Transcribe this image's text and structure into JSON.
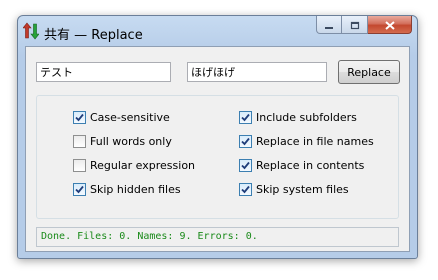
{
  "window": {
    "title": "共有 — Replace",
    "icon": "up-down-arrows-icon"
  },
  "caption": {
    "minimize_icon": "minimize-icon",
    "maximize_icon": "maximize-icon",
    "close_icon": "close-icon"
  },
  "search": {
    "find_value": "テスト",
    "replace_value": "ほげほげ"
  },
  "replace_button": {
    "label": "Replace"
  },
  "options": [
    {
      "label": "Case-sensitive",
      "checked": true
    },
    {
      "label": "Full words only",
      "checked": false
    },
    {
      "label": "Regular expression",
      "checked": false
    },
    {
      "label": "Skip hidden files",
      "checked": true
    },
    {
      "label": "Include subfolders",
      "checked": true
    },
    {
      "label": "Replace in file names",
      "checked": true
    },
    {
      "label": "Replace in contents",
      "checked": true
    },
    {
      "label": "Skip system files",
      "checked": true
    }
  ],
  "status": {
    "text": "Done. Files: 0. Names: 9. Errors: 0."
  },
  "colors": {
    "status_text": "#1a8a1a",
    "title_bar": "#b5cce8",
    "close_button": "#c3482f"
  }
}
